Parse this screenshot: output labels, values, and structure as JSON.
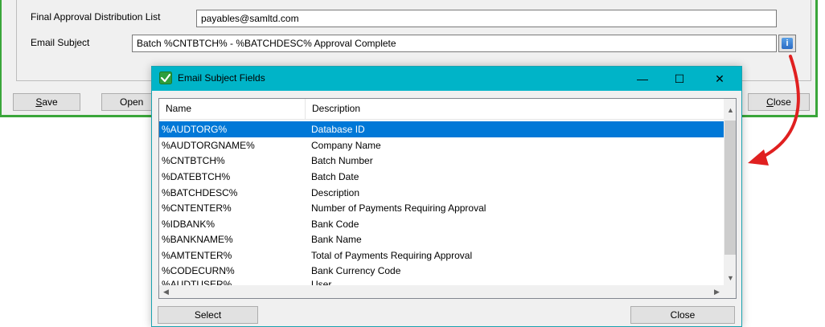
{
  "form": {
    "final_approval_label": "Final Approval Distribution List",
    "final_approval_value": "payables@samltd.com",
    "email_subject_label": "Email Subject",
    "email_subject_value": "Batch %CNTBTCH% - %BATCHDESC% Approval Complete",
    "info_button_glyph": "i",
    "save_label": "ave",
    "save_mnemonic": "S",
    "open_label": "Open",
    "close_label": "lose",
    "close_mnemonic": "C"
  },
  "dialog": {
    "title": "Email Subject Fields",
    "minimize_glyph": "—",
    "maximize_glyph": "☐",
    "close_glyph": "✕",
    "columns": [
      "Name",
      "Description"
    ],
    "rows": [
      {
        "name": "%AUDTORG%",
        "desc": "Database ID",
        "selected": true
      },
      {
        "name": "%AUDTORGNAME%",
        "desc": "Company Name"
      },
      {
        "name": "%CNTBTCH%",
        "desc": "Batch Number"
      },
      {
        "name": "%DATEBTCH%",
        "desc": "Batch Date"
      },
      {
        "name": "%BATCHDESC%",
        "desc": "Description"
      },
      {
        "name": "%CNTENTER%",
        "desc": "Number of Payments Requiring Approval"
      },
      {
        "name": "%IDBANK%",
        "desc": "Bank Code"
      },
      {
        "name": "%BANKNAME%",
        "desc": "Bank Name"
      },
      {
        "name": "%AMTENTER%",
        "desc": "Total of Payments Requiring Approval"
      },
      {
        "name": "%CODECURN%",
        "desc": "Bank Currency Code"
      },
      {
        "name": "%AUDTUSER%",
        "desc": "User"
      }
    ],
    "select_label": "Select",
    "close_label": "Close"
  },
  "colors": {
    "accent_green": "#3aa63a",
    "titlebar": "#00b4c8",
    "selection": "#0078d7",
    "arrow": "#e02020"
  }
}
